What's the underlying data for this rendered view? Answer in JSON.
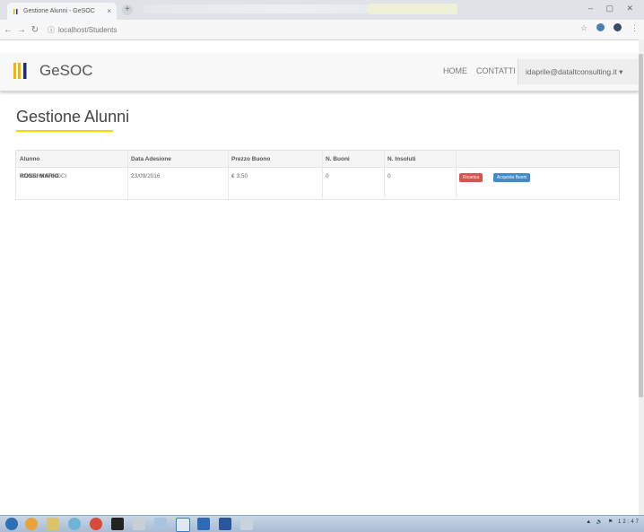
{
  "browser": {
    "tab_title": "Gestione Alunni - GeSOC",
    "tab_close": "×",
    "new_tab": "+",
    "url": "localhost/Students",
    "window_controls": "–  ▢  ✕"
  },
  "app": {
    "brand": "GeSOC",
    "nav": {
      "home": "HOME",
      "contatti": "CONTATTI",
      "user": "idaprile@dataltconsulting.it ▾"
    }
  },
  "page": {
    "title": "Gestione Alunni"
  },
  "table": {
    "headers": [
      "Alunno",
      "Data Adesione",
      "Prezzo Buono",
      "N. Buoni",
      "N. Insoluti",
      ""
    ],
    "rows": [
      {
        "alunno": "ROSSI MARIO",
        "alunno_sub": "22/09/2006, NOCI",
        "data_adesione": "23/09/2016",
        "prezzo": "€ 3,50",
        "buoni": "0",
        "insoluti": "0",
        "btn_ricarica": "Ricarica",
        "btn_acquista": "Acquista Buoni"
      }
    ]
  },
  "taskbar": {
    "tray": "▲ 🔈 ⚑ 12:47"
  },
  "colors": {
    "accent_yellow": "#ffd20a",
    "danger": "#d9534f",
    "primary": "#428bca"
  }
}
